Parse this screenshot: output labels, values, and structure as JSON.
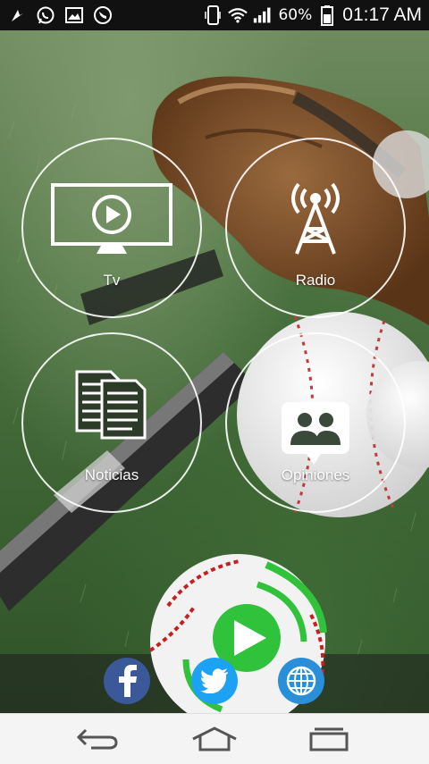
{
  "status_bar": {
    "battery_percent": "60%",
    "time": "01:17 AM",
    "icons": [
      "notification-flag-icon",
      "whatsapp-icon",
      "gallery-icon",
      "call-icon",
      "phone-vibrate-icon",
      "wifi-icon",
      "signal-icon",
      "battery-icon"
    ]
  },
  "menu": {
    "tv": {
      "label": "Tv",
      "icon": "tv-play-icon"
    },
    "radio": {
      "label": "Radio",
      "icon": "radio-tower-icon"
    },
    "noticias": {
      "label": "Noticias",
      "icon": "documents-icon"
    },
    "opiniones": {
      "label": "Opiniones",
      "icon": "group-chat-icon"
    }
  },
  "social": {
    "facebook": {
      "icon": "facebook-icon",
      "color": "#3b5998"
    },
    "twitter": {
      "icon": "twitter-icon",
      "color": "#1da1f2"
    },
    "web": {
      "icon": "globe-icon",
      "color": "#2a8fd8"
    }
  },
  "center_logo": {
    "icon": "baseball-play-logo",
    "accent": "#2fc23a"
  },
  "nav": {
    "back": {
      "icon": "back-arrow-icon"
    },
    "home": {
      "icon": "home-icon"
    },
    "recents": {
      "icon": "recent-apps-icon"
    }
  }
}
